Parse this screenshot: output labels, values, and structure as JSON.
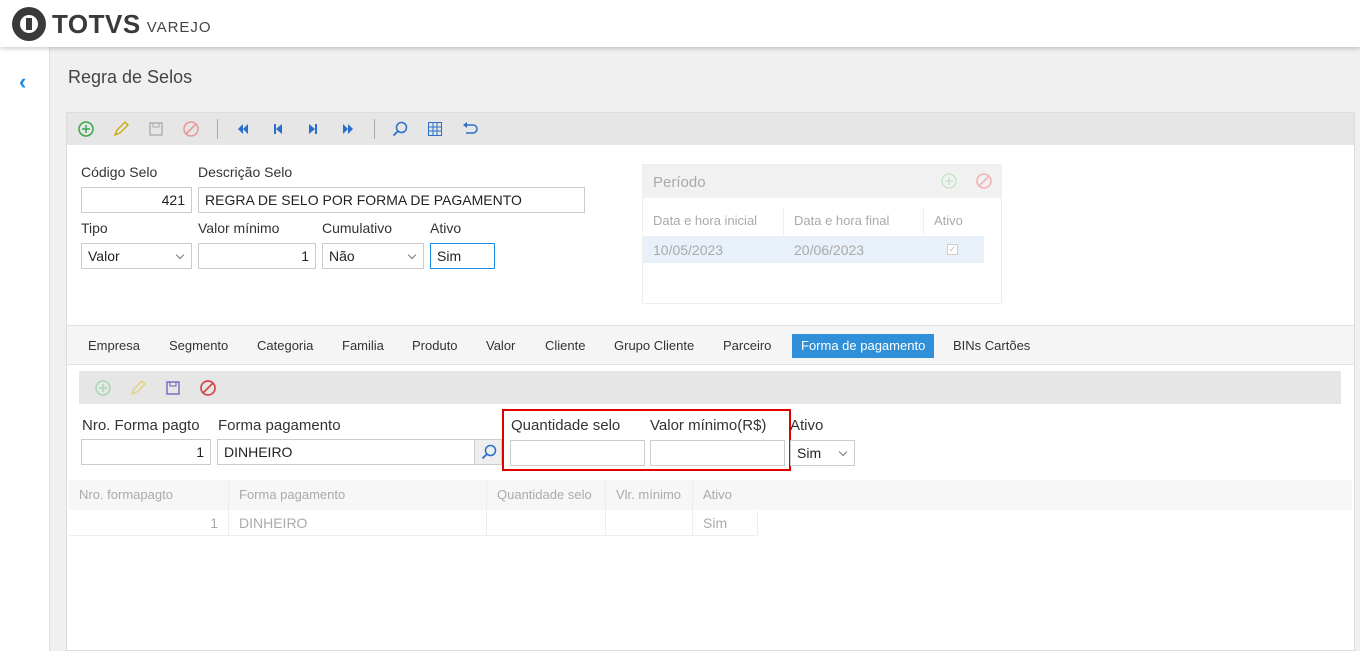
{
  "brand": {
    "name": "TOTVS",
    "sub": "VAREJO"
  },
  "page": {
    "title": "Regra de Selos"
  },
  "toolbar": {
    "icons": [
      "add-icon",
      "edit-icon",
      "save-icon",
      "cancel-icon",
      "first-icon",
      "prev-icon",
      "next-icon",
      "last-icon",
      "search-icon",
      "grid-icon",
      "undo-icon"
    ]
  },
  "form": {
    "codigo_label": "Código Selo",
    "codigo_value": "421",
    "descricao_label": "Descrição Selo",
    "descricao_value": "REGRA DE SELO POR FORMA DE PAGAMENTO",
    "tipo_label": "Tipo",
    "tipo_value": "Valor",
    "valor_min_label": "Valor mínimo",
    "valor_min_value": "1",
    "cumulativo_label": "Cumulativo",
    "cumulativo_value": "Não",
    "ativo_label": "Ativo",
    "ativo_value": "Sim"
  },
  "periodo": {
    "title": "Período",
    "columns": [
      "Data e hora inicial",
      "Data e hora final",
      "Ativo"
    ],
    "rows": [
      {
        "inicio": "10/05/2023",
        "fim": "20/06/2023",
        "ativo": true
      }
    ]
  },
  "tabs": [
    "Empresa",
    "Segmento",
    "Categoria",
    "Familia",
    "Produto",
    "Valor",
    "Cliente",
    "Grupo Cliente",
    "Parceiro",
    "Forma de pagamento",
    "BINs Cartões"
  ],
  "active_tab": "Forma de pagamento",
  "pagamento": {
    "nro_label": "Nro. Forma pagto",
    "nro_value": "1",
    "forma_label": "Forma pagamento",
    "forma_value": "DINHEIRO",
    "qtd_label": "Quantidade selo",
    "qtd_value": "",
    "valor_label": "Valor mínimo(R$)",
    "valor_value": "",
    "ativo_label": "Ativo",
    "ativo_value": "Sim",
    "columns": [
      "Nro. formapagto",
      "Forma pagamento",
      "Quantidade selo",
      "Vlr. mínimo",
      "Ativo"
    ],
    "rows": [
      {
        "nro": "1",
        "forma": "DINHEIRO",
        "qtd": "",
        "vlr": "",
        "ativo": "Sim"
      }
    ]
  }
}
